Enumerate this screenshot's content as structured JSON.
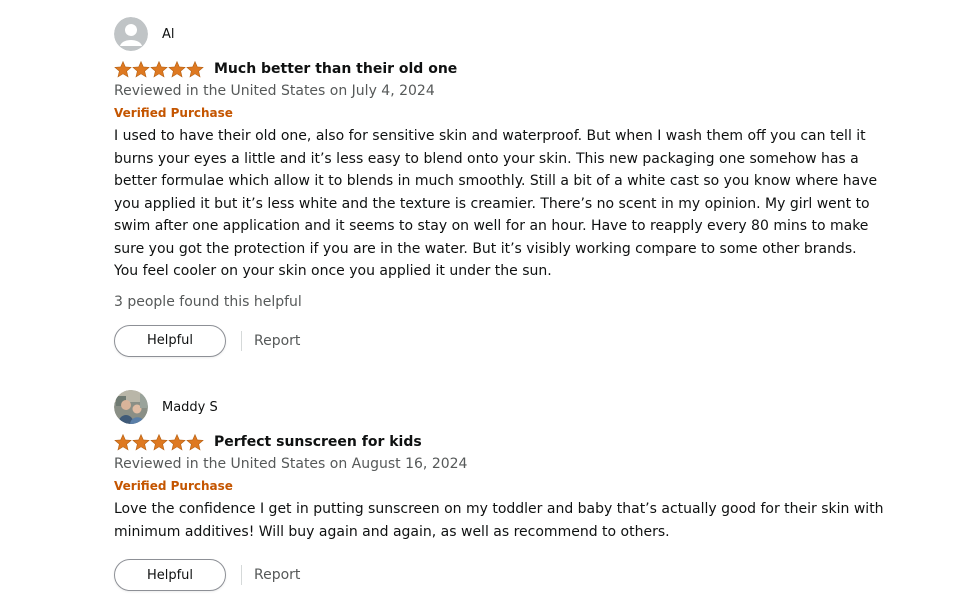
{
  "reviews": [
    {
      "reviewer": "Al",
      "avatar_icon": "default-person-avatar-icon",
      "rating": 5,
      "title": "Much better than their old one",
      "date": "Reviewed in the United States on July 4, 2024",
      "verified": "Verified Purchase",
      "body": "I used to have their old one, also for sensitive skin and waterproof. But when I wash them off you can tell it burns your eyes a little and it’s less easy to blend onto your skin. This new packaging one somehow has a better formulae which allow it to blends in much smoothly. Still a bit of a white cast so you know where have you applied it but it’s less white and the texture is creamier. There’s no scent in my opinion. My girl went to swim after one application and it seems to stay on well for an hour. Have to reapply every 80 mins to make sure you got the protection if you are in the water. But it’s visibly working compare to some other brands. You feel cooler on your skin once you applied it under the sun.",
      "helpful_count": "3 people found this helpful",
      "helpful_label": "Helpful",
      "report_label": "Report"
    },
    {
      "reviewer": "Maddy S",
      "avatar_icon": "user-photo-avatar",
      "rating": 5,
      "title": "Perfect sunscreen for kids",
      "date": "Reviewed in the United States on August 16, 2024",
      "verified": "Verified Purchase",
      "body": "Love the confidence I get in putting sunscreen on my toddler and baby that’s actually good for their skin with minimum additives! Will buy again and again, as well as recommend to others.",
      "helpful_label": "Helpful",
      "report_label": "Report"
    }
  ],
  "colors": {
    "star": "#de7921",
    "verified": "#c45500",
    "muted_text": "#565959",
    "text": "#0f1111"
  }
}
